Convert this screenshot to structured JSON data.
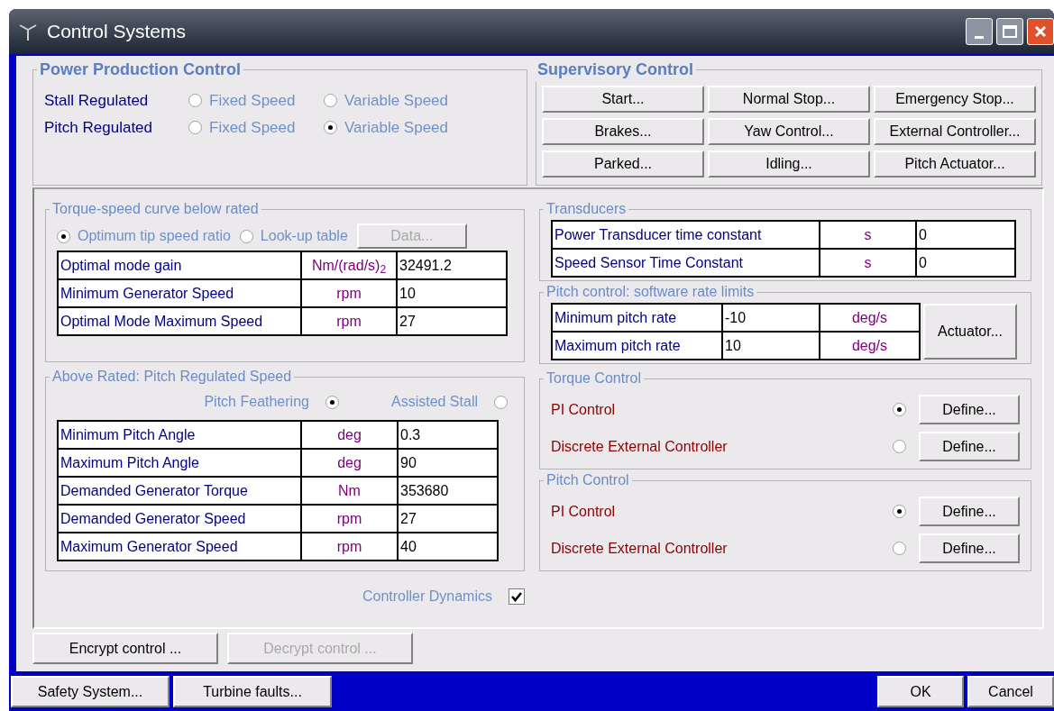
{
  "window": {
    "title": "Control Systems"
  },
  "power_production": {
    "title": "Power Production Control",
    "rows": [
      {
        "label": "Stall Regulated",
        "options": [
          {
            "label": "Fixed Speed",
            "selected": false
          },
          {
            "label": "Variable Speed",
            "selected": false
          }
        ]
      },
      {
        "label": "Pitch Regulated",
        "options": [
          {
            "label": "Fixed Speed",
            "selected": false
          },
          {
            "label": "Variable Speed",
            "selected": true
          }
        ]
      }
    ]
  },
  "supervisory": {
    "title": "Supervisory Control",
    "buttons": [
      "Start...",
      "Normal Stop...",
      "Emergency Stop...",
      "Brakes...",
      "Yaw Control...",
      "External Controller...",
      "Parked...",
      "Idling...",
      "Pitch Actuator..."
    ]
  },
  "torque_speed": {
    "title": "Torque-speed curve below rated",
    "options": [
      {
        "label": "Optimum tip speed ratio",
        "selected": true
      },
      {
        "label": "Look-up table",
        "selected": false
      }
    ],
    "data_button": {
      "label": "Data...",
      "disabled": true
    },
    "rows": [
      {
        "label": "Optimal mode gain",
        "unit": "Nm/(rad/s)$_{2}$",
        "value": "32491.2"
      },
      {
        "label": "Minimum Generator Speed",
        "unit": "rpm",
        "value": "10"
      },
      {
        "label": "Optimal Mode Maximum Speed",
        "unit": "rpm",
        "value": "27"
      }
    ]
  },
  "above_rated": {
    "title": "Above Rated: Pitch Regulated Speed",
    "options": [
      {
        "label": "Pitch Feathering",
        "selected": true
      },
      {
        "label": "Assisted Stall",
        "selected": false
      }
    ],
    "rows": [
      {
        "label": "Minimum Pitch Angle",
        "unit": "deg",
        "value": "0.3"
      },
      {
        "label": "Maximum Pitch Angle",
        "unit": "deg",
        "value": "90"
      },
      {
        "label": "Demanded Generator Torque",
        "unit": "Nm",
        "value": "353680"
      },
      {
        "label": "Demanded Generator Speed",
        "unit": "rpm",
        "value": "27"
      },
      {
        "label": "Maximum Generator Speed",
        "unit": "rpm",
        "value": "40"
      }
    ]
  },
  "controller_dynamics": {
    "label": "Controller Dynamics",
    "checked": true
  },
  "transducers": {
    "title": "Transducers",
    "rows": [
      {
        "label": "Power Transducer time constant",
        "unit": "s",
        "value": "0"
      },
      {
        "label": "Speed Sensor Time Constant",
        "unit": "s",
        "value": "0"
      }
    ]
  },
  "pitch_rate_limits": {
    "title": "Pitch control: software rate limits",
    "rows": [
      {
        "label": "Minimum pitch rate",
        "value": "-10",
        "unit": "deg/s"
      },
      {
        "label": "Maximum pitch rate",
        "value": "10",
        "unit": "deg/s"
      }
    ],
    "button": "Actuator..."
  },
  "torque_control": {
    "title": "Torque Control",
    "options": [
      {
        "label": "PI Control",
        "selected": true,
        "button": "Define..."
      },
      {
        "label": "Discrete External Controller",
        "selected": false,
        "button": "Define..."
      }
    ]
  },
  "pitch_control": {
    "title": "Pitch Control",
    "options": [
      {
        "label": "PI Control",
        "selected": true,
        "button": "Define..."
      },
      {
        "label": "Discrete External Controller",
        "selected": false,
        "button": "Define..."
      }
    ]
  },
  "encrypt_buttons": [
    {
      "label": "Encrypt control ...",
      "disabled": false
    },
    {
      "label": "Decrypt control ...",
      "disabled": true
    }
  ],
  "footer": {
    "left_buttons": [
      "Safety System...",
      "Turbine faults..."
    ],
    "right_buttons": [
      "OK",
      "Cancel"
    ]
  }
}
